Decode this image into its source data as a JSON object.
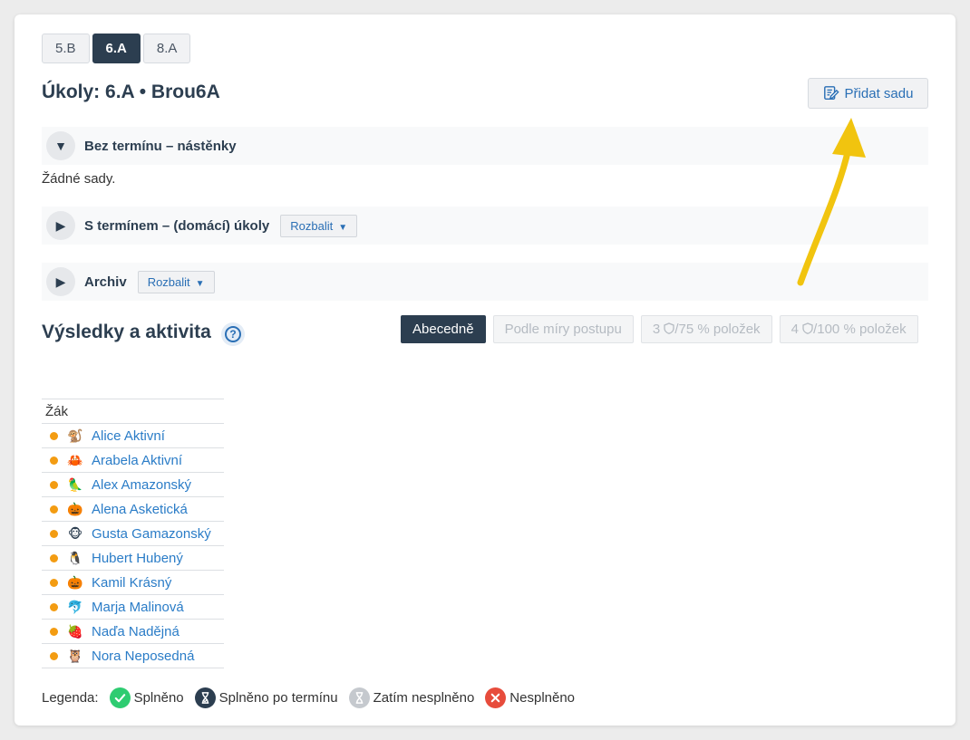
{
  "class_tabs": [
    {
      "label": "5.B",
      "active": false
    },
    {
      "label": "6.A",
      "active": true
    },
    {
      "label": "8.A",
      "active": false
    }
  ],
  "page_title": "Úkoly: 6.A • Brou6A",
  "add_set_label": "Přidat sadu",
  "sections": {
    "no_deadline": {
      "label": "Bez termínu – nástěnky",
      "toggle": "▼",
      "empty_text": "Žádné sady."
    },
    "with_deadline": {
      "label": "S termínem – (domácí) úkoly",
      "toggle": "▶",
      "expand_label": "Rozbalit"
    },
    "archive": {
      "label": "Archiv",
      "toggle": "▶",
      "expand_label": "Rozbalit"
    }
  },
  "results": {
    "title": "Výsledky a aktivita",
    "help": "?",
    "sort_buttons": [
      {
        "label": "Abecedně",
        "active": true
      },
      {
        "label": "Podle míry postupu",
        "active": false
      },
      {
        "label_prefix": "3",
        "label_suffix": "/75 % položek",
        "active": false
      },
      {
        "label_prefix": "4",
        "label_suffix": "/100 % položek",
        "active": false
      }
    ]
  },
  "table": {
    "header": "Žák",
    "students": [
      {
        "name": "Alice Aktivní",
        "avatar": "🐒"
      },
      {
        "name": "Arabela Aktivní",
        "avatar": "🦀"
      },
      {
        "name": "Alex Amazonský",
        "avatar": "🦜"
      },
      {
        "name": "Alena Asketická",
        "avatar": "🎃"
      },
      {
        "name": "Gusta Gamazonský",
        "avatar": "🐵"
      },
      {
        "name": "Hubert Hubený",
        "avatar": "🐧"
      },
      {
        "name": "Kamil Krásný",
        "avatar": "🎃"
      },
      {
        "name": "Marja Malinová",
        "avatar": "🐬"
      },
      {
        "name": "Naďa Nadějná",
        "avatar": "🍓"
      },
      {
        "name": "Nora Neposedná",
        "avatar": "🦉"
      }
    ]
  },
  "legend": {
    "label": "Legenda:",
    "items": [
      {
        "label": "Splněno",
        "color": "#2ecc71",
        "icon": "check-icon"
      },
      {
        "label": "Splněno po termínu",
        "color": "#2c3e50",
        "icon": "hourglass-done-icon"
      },
      {
        "label": "Zatím nesplněno",
        "color": "#c5c9ce",
        "icon": "hourglass-icon"
      },
      {
        "label": "Nesplněno",
        "color": "#e74c3c",
        "icon": "cross-icon"
      }
    ]
  },
  "colors": {
    "accent": "#2c3e50",
    "link": "#2a7cc7",
    "status_dot": "#f39c12",
    "annotation_arrow": "#f1c40f"
  }
}
